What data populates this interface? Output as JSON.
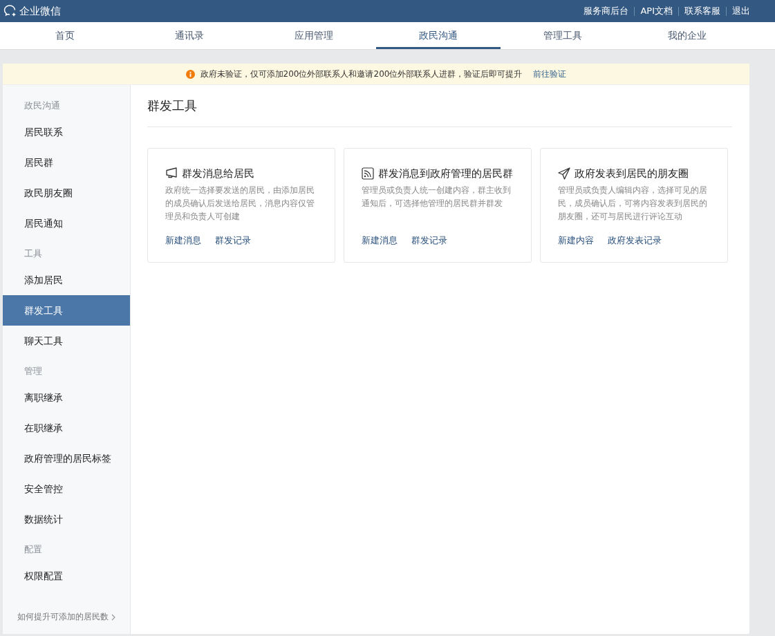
{
  "brand": "企业微信",
  "top_links": [
    "服务商后台",
    "API文档",
    "联系客服",
    "退出"
  ],
  "tabs": [
    {
      "label": "首页",
      "selected": false
    },
    {
      "label": "通讯录",
      "selected": false
    },
    {
      "label": "应用管理",
      "selected": false
    },
    {
      "label": "政民沟通",
      "selected": true
    },
    {
      "label": "管理工具",
      "selected": false
    },
    {
      "label": "我的企业",
      "selected": false
    }
  ],
  "banner": {
    "text": "政府未验证，仅可添加200位外部联系人和邀请200位外部联系人进群，验证后即可提升",
    "link": "前往验证"
  },
  "sidebar": {
    "groups": [
      {
        "title": "政民沟通",
        "items": [
          {
            "label": "居民联系",
            "selected": false
          },
          {
            "label": "居民群",
            "selected": false
          },
          {
            "label": "政民朋友圈",
            "selected": false
          },
          {
            "label": "居民通知",
            "selected": false
          }
        ]
      },
      {
        "title": "工具",
        "items": [
          {
            "label": "添加居民",
            "selected": false
          },
          {
            "label": "群发工具",
            "selected": true
          },
          {
            "label": "聊天工具",
            "selected": false
          }
        ]
      },
      {
        "title": "管理",
        "items": [
          {
            "label": "离职继承",
            "selected": false
          },
          {
            "label": "在职继承",
            "selected": false
          },
          {
            "label": "政府管理的居民标签",
            "selected": false
          },
          {
            "label": "安全管控",
            "selected": false
          },
          {
            "label": "数据统计",
            "selected": false
          }
        ]
      },
      {
        "title": "配置",
        "items": [
          {
            "label": "权限配置",
            "selected": false
          }
        ]
      }
    ],
    "footer_link": "如何提升可添加的居民数"
  },
  "page_title": "群发工具",
  "cards": [
    {
      "kind": "megaphone",
      "title": "群发消息给居民",
      "description": "政府统一选择要发送的居民，由添加居民的成员确认后发送给居民，消息内容仅管理员和负责人可创建",
      "links": [
        "新建消息",
        "群发记录"
      ]
    },
    {
      "kind": "broadcast",
      "title": "群发消息到政府管理的居民群",
      "description": "管理员或负责人统一创建内容，群主收到通知后，可选择他管理的居民群并群发",
      "links": [
        "新建消息",
        "群发记录"
      ]
    },
    {
      "kind": "send",
      "title": "政府发表到居民的朋友圈",
      "description": "管理员或负责人编辑内容，选择可见的居民，成员确认后，可将内容发表到居民的朋友圈，还可与居民进行评论互动",
      "links": [
        "新建内容",
        "政府发表记录"
      ]
    }
  ]
}
